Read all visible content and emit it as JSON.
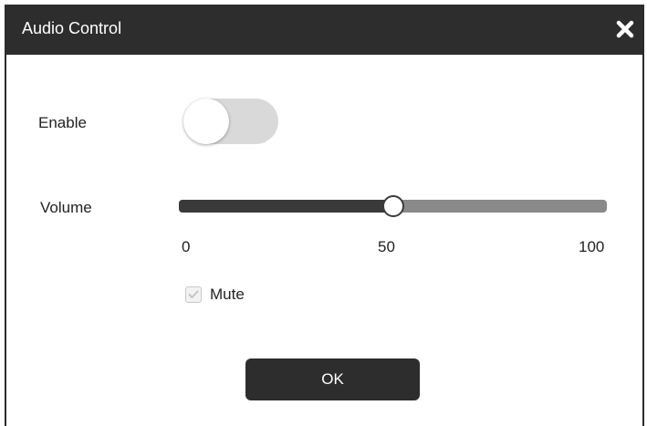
{
  "dialog": {
    "title": "Audio Control",
    "close_icon": "close-icon"
  },
  "enable": {
    "label": "Enable",
    "value": false
  },
  "volume": {
    "label": "Volume",
    "min_label": "0",
    "mid_label": "50",
    "max_label": "100",
    "min": 0,
    "max": 100,
    "value": 50
  },
  "mute": {
    "label": "Mute",
    "checked": true,
    "disabled": true
  },
  "ok_button": {
    "label": "OK"
  },
  "colors": {
    "titlebar": "#2d2d2d",
    "toggle_off": "#d9d9d9",
    "slider_filled": "#3a3a3a",
    "slider_track": "#8a8a8a",
    "button": "#2d2d2d"
  }
}
